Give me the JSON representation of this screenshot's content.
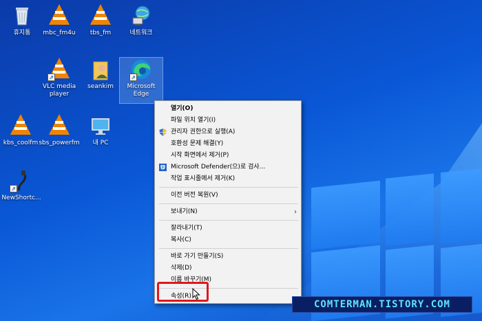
{
  "desktop": {
    "icons": [
      {
        "label": "휴지통"
      },
      {
        "label": "mbc_fm4u"
      },
      {
        "label": "tbs_fm"
      },
      {
        "label": "네트워크"
      },
      {
        "label": "VLC media player"
      },
      {
        "label": "seankim"
      },
      {
        "label": "Microsoft Edge"
      },
      {
        "label": "kbs_coolfm"
      },
      {
        "label": "sbs_powerfm"
      },
      {
        "label": "내 PC"
      },
      {
        "label": "NewShortc..."
      }
    ]
  },
  "context_menu": {
    "items": [
      {
        "label": "열기(O)"
      },
      {
        "label": "파일 위치 열기(I)"
      },
      {
        "label": "관리자 권한으로 실행(A)"
      },
      {
        "label": "호환성 문제 해결(Y)"
      },
      {
        "label": "시작 화면에서 제거(P)"
      },
      {
        "label": "Microsoft Defender(으)로 검사..."
      },
      {
        "label": "작업 표시줄에서 제거(K)"
      },
      {
        "label": "이전 버전 복원(V)"
      },
      {
        "label": "보내기(N)"
      },
      {
        "label": "잘라내기(T)"
      },
      {
        "label": "복사(C)"
      },
      {
        "label": "바로 가기 만들기(S)"
      },
      {
        "label": "삭제(D)"
      },
      {
        "label": "이름 바꾸기(M)"
      },
      {
        "label": "속성(R)"
      }
    ]
  },
  "watermark": "COMTERMAN.TISTORY.COM",
  "colors": {
    "highlight": "#e1161c",
    "vlc_orange": "#f08400",
    "menu_bg": "#f2f2f2"
  }
}
